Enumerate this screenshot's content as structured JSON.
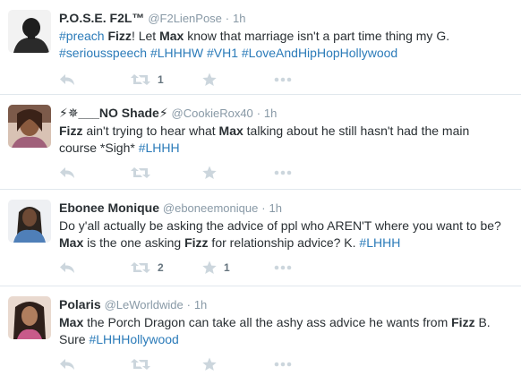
{
  "colors": {
    "link": "#2b7bb9",
    "meta": "#8899a6",
    "icon": "#ccd6dd",
    "divider": "#e1e8ed",
    "text": "#292f33"
  },
  "tweets": [
    {
      "name": "P.O.S.E. F2L™",
      "handle": "@F2LienPose",
      "time": "1h",
      "avatar_icon": "user-avatar-icon",
      "text_parts": [
        {
          "t": "#preach",
          "s": "hashtag"
        },
        {
          "t": " ",
          "s": ""
        },
        {
          "t": "Fizz",
          "s": "bold"
        },
        {
          "t": "! Let ",
          "s": ""
        },
        {
          "t": "Max",
          "s": "bold"
        },
        {
          "t": " know that marriage isn't a part time thing my G.",
          "s": ""
        },
        {
          "t": "\n",
          "s": "br"
        },
        {
          "t": "#seriousspeech",
          "s": "hashtag"
        },
        {
          "t": " ",
          "s": ""
        },
        {
          "t": "#LHHHW",
          "s": "hashtag"
        },
        {
          "t": " ",
          "s": ""
        },
        {
          "t": "#VH1",
          "s": "hashtag"
        },
        {
          "t": " ",
          "s": ""
        },
        {
          "t": "#LoveAndHipHopHollywood",
          "s": "hashtag"
        }
      ],
      "retweet_count": "1",
      "favorite_count": ""
    },
    {
      "name": "⚡✵___NO Shade⚡",
      "handle": "@CookieRox40",
      "time": "1h",
      "avatar_icon": "user-avatar-icon",
      "text_parts": [
        {
          "t": "Fizz",
          "s": "bold"
        },
        {
          "t": " ain't trying to hear what ",
          "s": ""
        },
        {
          "t": "Max",
          "s": "bold"
        },
        {
          "t": " talking about he still hasn't had the main",
          "s": ""
        },
        {
          "t": "\n",
          "s": "br"
        },
        {
          "t": "course *Sigh* ",
          "s": ""
        },
        {
          "t": "#LHHH",
          "s": "hashtag"
        }
      ],
      "retweet_count": "",
      "favorite_count": ""
    },
    {
      "name": "Ebonee Monique",
      "handle": "@eboneemonique",
      "time": "1h",
      "avatar_icon": "user-avatar-icon",
      "text_parts": [
        {
          "t": "Do y'all actually be asking the advice of ppl who AREN'T where you want to be?",
          "s": ""
        },
        {
          "t": "\n",
          "s": "br"
        },
        {
          "t": "Max",
          "s": "bold"
        },
        {
          "t": " is the one asking ",
          "s": ""
        },
        {
          "t": "Fizz",
          "s": "bold"
        },
        {
          "t": " for relationship advice? K. ",
          "s": ""
        },
        {
          "t": "#LHHH",
          "s": "hashtag"
        }
      ],
      "retweet_count": "2",
      "favorite_count": "1"
    },
    {
      "name": "Polaris",
      "handle": "@LeWorldwide",
      "time": "1h",
      "avatar_icon": "user-avatar-icon",
      "text_parts": [
        {
          "t": "Max",
          "s": "bold"
        },
        {
          "t": " the Porch Dragon can take all the ashy ass advice he wants from ",
          "s": ""
        },
        {
          "t": "Fizz",
          "s": "bold"
        },
        {
          "t": " B.",
          "s": ""
        },
        {
          "t": "\n",
          "s": "br"
        },
        {
          "t": "Sure ",
          "s": ""
        },
        {
          "t": "#LHHHollywood",
          "s": "hashtag"
        }
      ],
      "retweet_count": "",
      "favorite_count": ""
    }
  ]
}
